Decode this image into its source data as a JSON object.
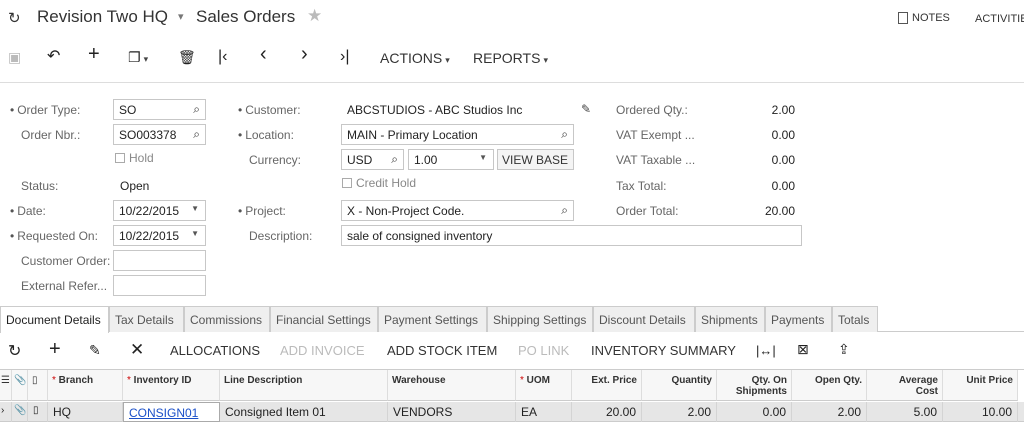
{
  "header": {
    "company": "Revision Two HQ",
    "title": "Sales Orders",
    "notes_label": "NOTES",
    "activities_label": "ACTIVITIES"
  },
  "toolbar": {
    "actions_label": "ACTIONS",
    "reports_label": "REPORTS"
  },
  "form": {
    "order_type": {
      "label": "Order Type:",
      "value": "SO"
    },
    "order_nbr": {
      "label": "Order Nbr.:",
      "value": "SO003378"
    },
    "hold_label": "Hold",
    "status": {
      "label": "Status:",
      "value": "Open"
    },
    "date": {
      "label": "Date:",
      "value": "10/22/2015"
    },
    "requested_on": {
      "label": "Requested On:",
      "value": "10/22/2015"
    },
    "customer_order": {
      "label": "Customer Order:",
      "value": ""
    },
    "external_ref": {
      "label": "External Refer...",
      "value": ""
    },
    "customer": {
      "label": "Customer:",
      "value": "ABCSTUDIOS - ABC Studios Inc"
    },
    "location": {
      "label": "Location:",
      "value": "MAIN - Primary Location"
    },
    "currency": {
      "label": "Currency:",
      "value": "USD",
      "rate": "1.00",
      "view_base_label": "VIEW BASE"
    },
    "credit_hold_label": "Credit Hold",
    "project": {
      "label": "Project:",
      "value": "X - Non-Project Code."
    },
    "description": {
      "label": "Description:",
      "value": "sale of consigned inventory"
    },
    "totals": [
      {
        "label": "Ordered Qty.:",
        "value": "2.00"
      },
      {
        "label": "VAT Exempt ...",
        "value": "0.00"
      },
      {
        "label": "VAT Taxable ...",
        "value": "0.00"
      },
      {
        "label": "Tax Total:",
        "value": "0.00"
      },
      {
        "label": "Order Total:",
        "value": "20.00"
      }
    ]
  },
  "tabs": [
    "Document Details",
    "Tax Details",
    "Commissions",
    "Financial Settings",
    "Payment Settings",
    "Shipping Settings",
    "Discount Details",
    "Shipments",
    "Payments",
    "Totals"
  ],
  "grid_toolbar": {
    "allocations": "ALLOCATIONS",
    "add_invoice": "ADD INVOICE",
    "add_stock_item": "ADD STOCK ITEM",
    "po_link": "PO LINK",
    "inventory_summary": "INVENTORY SUMMARY"
  },
  "grid": {
    "columns": {
      "branch": "Branch",
      "inventory_id": "Inventory ID",
      "line_description": "Line Description",
      "warehouse": "Warehouse",
      "uom": "UOM",
      "ext_price": "Ext. Price",
      "quantity": "Quantity",
      "qty_on_shipments_1": "Qty. On",
      "qty_on_shipments_2": "Shipments",
      "open_qty": "Open Qty.",
      "average_cost_1": "Average",
      "average_cost_2": "Cost",
      "unit_price": "Unit Price"
    },
    "rows": [
      {
        "branch": "HQ",
        "inventory_id": "CONSIGN01",
        "line_description": "Consigned Item 01",
        "warehouse": "VENDORS",
        "uom": "EA",
        "ext_price": "20.00",
        "quantity": "2.00",
        "qty_on_shipments": "0.00",
        "open_qty": "2.00",
        "average_cost": "5.00",
        "unit_price": "10.00"
      }
    ]
  }
}
